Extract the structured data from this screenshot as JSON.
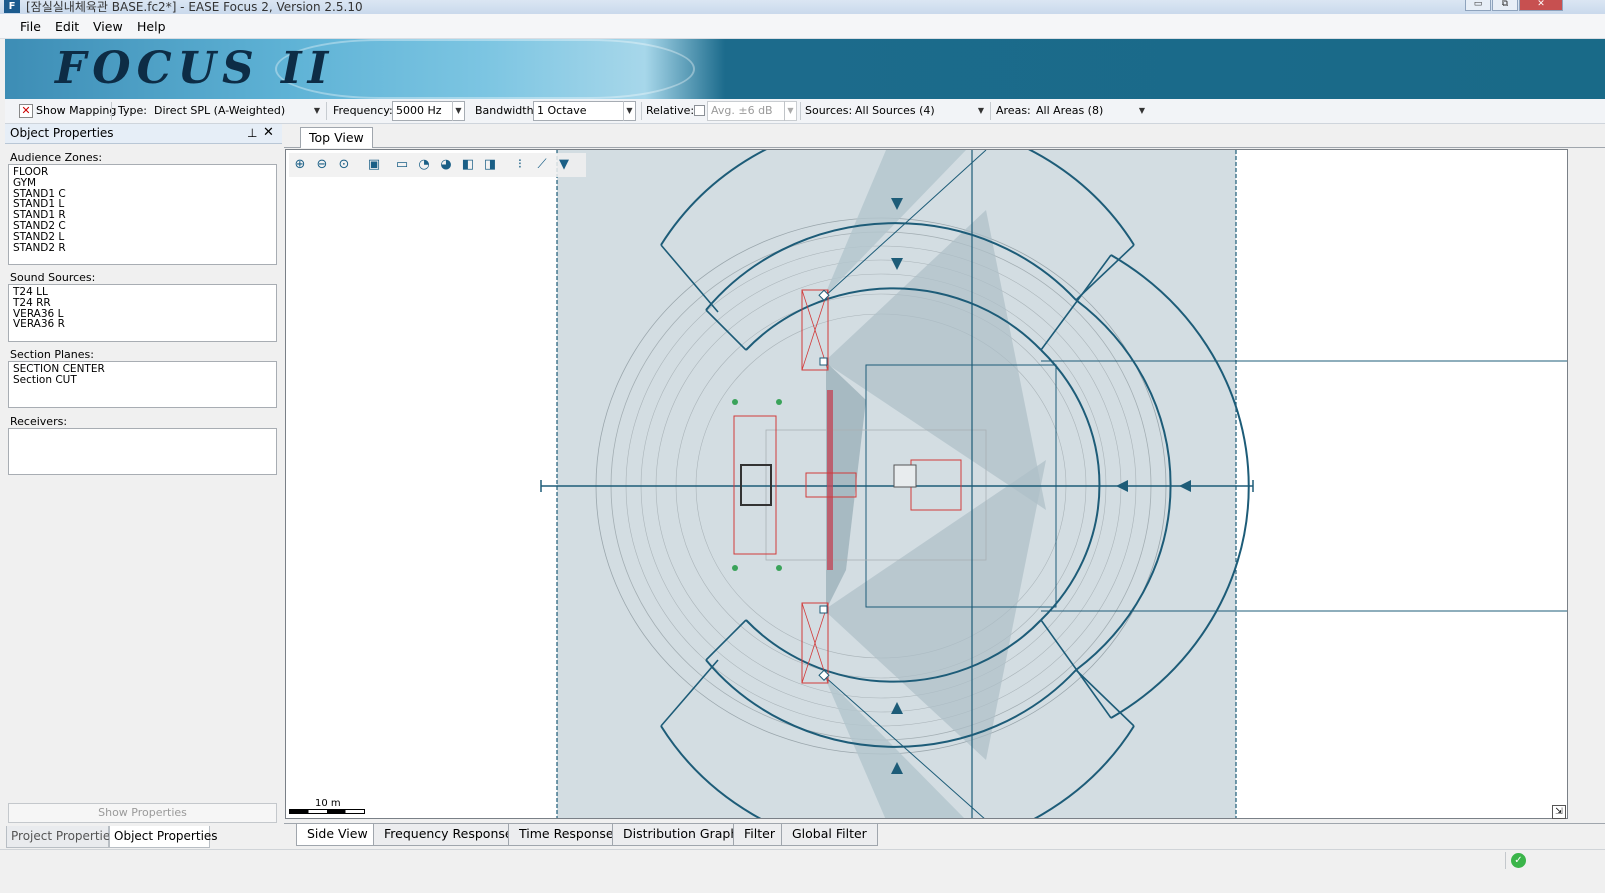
{
  "window": {
    "title": "[잠실실내체육관 BASE.fc2*] - EASE Focus 2, Version 2.5.10",
    "icon_label": "F",
    "buttons": [
      "▭",
      "⧉",
      "✕"
    ]
  },
  "menu": {
    "items": [
      "File",
      "Edit",
      "View",
      "Help"
    ]
  },
  "banner": {
    "logo_text": "FOCUS II"
  },
  "toolbar": {
    "show_mapping_label": "Show Mapping",
    "type_label": "Type:",
    "type_value": "Direct SPL (A-Weighted)",
    "frequency_label": "Frequency:",
    "frequency_value": "5000 Hz",
    "bandwidth_label": "Bandwidth:",
    "bandwidth_value": "1 Octave",
    "relative_label": "Relative:",
    "avg_value": "Avg. ±6 dB",
    "sources_label": "Sources:",
    "sources_value": "All Sources (4)",
    "areas_label": "Areas:",
    "areas_value": "All Areas (8)"
  },
  "left_panel": {
    "title": "Object Properties",
    "audience_zones_label": "Audience Zones:",
    "audience_zones": [
      "FLOOR",
      "GYM",
      "STAND1 C",
      "STAND1 L",
      "STAND1 R",
      "STAND2 C",
      "STAND2 L",
      "STAND2 R"
    ],
    "sound_sources_label": "Sound Sources:",
    "sound_sources": [
      "T24 LL",
      "T24 RR",
      "VERA36 L",
      "VERA36 R"
    ],
    "section_planes_label": "Section Planes:",
    "section_planes": [
      "SECTION CENTER",
      "Section CUT"
    ],
    "receivers_label": "Receivers:",
    "show_properties_label": "Show Properties",
    "tabs": [
      "Project Properties",
      "Object Properties"
    ]
  },
  "view": {
    "top_tab": "Top View",
    "scale_label": "10 m",
    "bottom_tabs": [
      "Side View",
      "Frequency Response",
      "Time Response",
      "Distribution Graph",
      "Filter",
      "Global Filter"
    ]
  },
  "colors": {
    "banner": "#196a88",
    "plan_shade": "#d3dde2",
    "plan_line": "#1d5c78",
    "truss_red": "#d23a3a"
  }
}
